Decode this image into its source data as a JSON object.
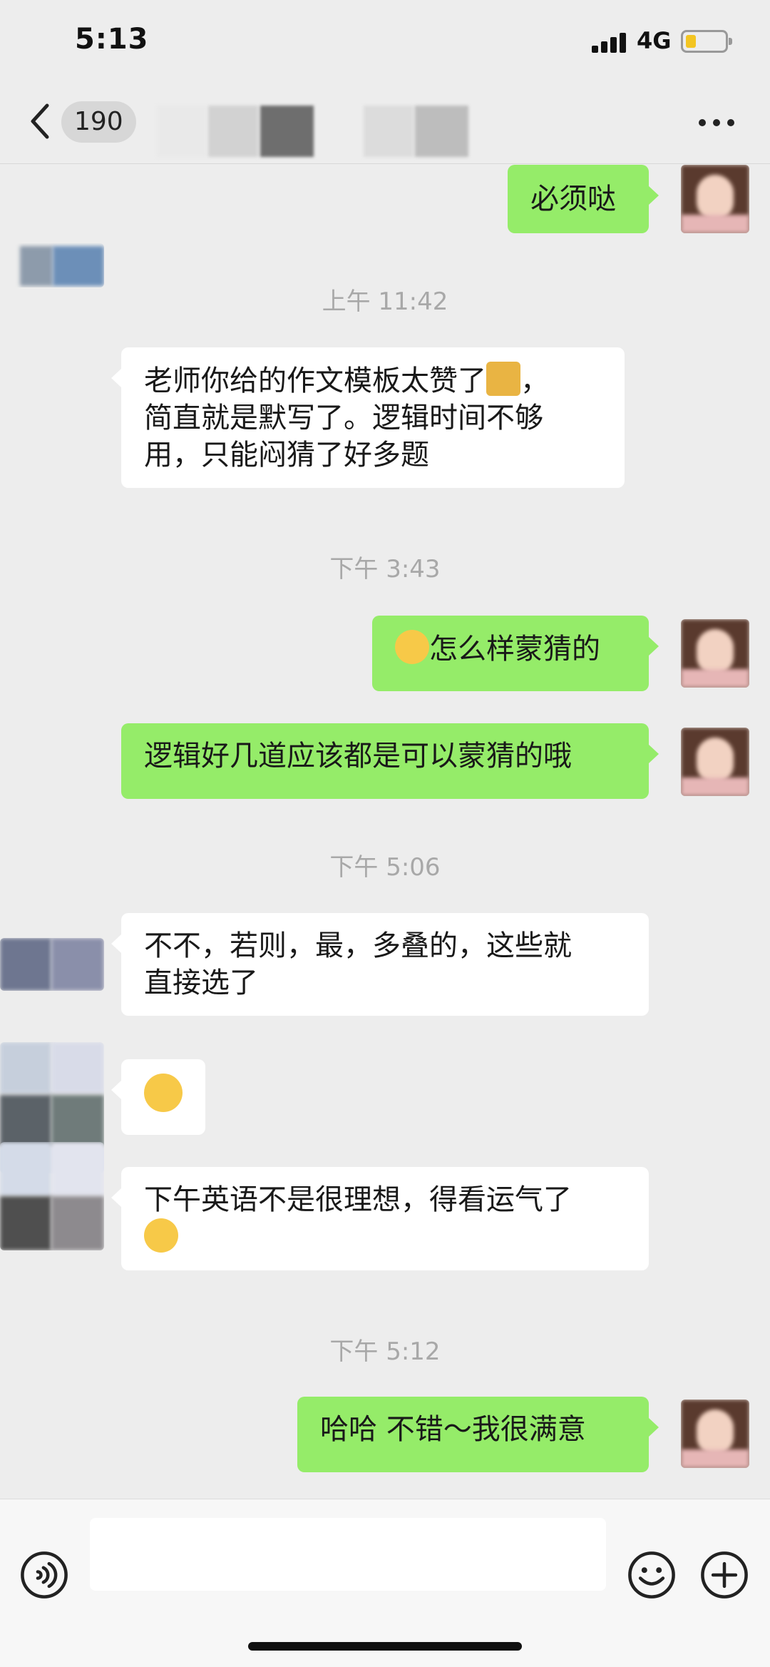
{
  "status_bar": {
    "time": "5:13",
    "network": "4G",
    "battery_icon": "battery-low-icon",
    "signal_icon": "signal-bars-icon"
  },
  "nav": {
    "back_icon": "chevron-left-icon",
    "unread_count": "190",
    "more_icon": "more-dots-icon"
  },
  "colors": {
    "background": "#ededed",
    "incoming_bubble": "#ffffff",
    "outgoing_bubble": "#95ec69",
    "timestamp": "#a8a8a8"
  },
  "messages": [
    {
      "type": "out",
      "text": "必须哒"
    },
    {
      "type": "time",
      "text": "上午 11:42"
    },
    {
      "type": "in",
      "lines": [
        "老师你给的作文模板太赞了",
        "，",
        "简直就是默写了。逻辑时间不够",
        "用，只能闷猜了好多题"
      ],
      "emoji": "thumbs-up-icon"
    },
    {
      "type": "time",
      "text": "下午 3:43"
    },
    {
      "type": "out",
      "text": "怎么样蒙猜的",
      "emoji": "grinning-face-icon"
    },
    {
      "type": "out",
      "text": "逻辑好几道应该都是可以蒙猜的哦"
    },
    {
      "type": "time",
      "text": "下午 5:06"
    },
    {
      "type": "in",
      "lines": [
        "不不，若则，最，多叠的，这些就",
        "直接选了"
      ]
    },
    {
      "type": "in",
      "emoji": "grinning-face-icon"
    },
    {
      "type": "in",
      "lines": [
        "下午英语不是很理想，得看运气了"
      ],
      "emoji": "laughing-crying-face-icon"
    },
    {
      "type": "time",
      "text": "下午 5:12"
    },
    {
      "type": "out",
      "text": "哈哈 不错～我很满意"
    }
  ],
  "input_bar": {
    "voice_icon": "voice-icon",
    "emoji_icon": "smiley-icon",
    "plus_icon": "plus-icon"
  }
}
